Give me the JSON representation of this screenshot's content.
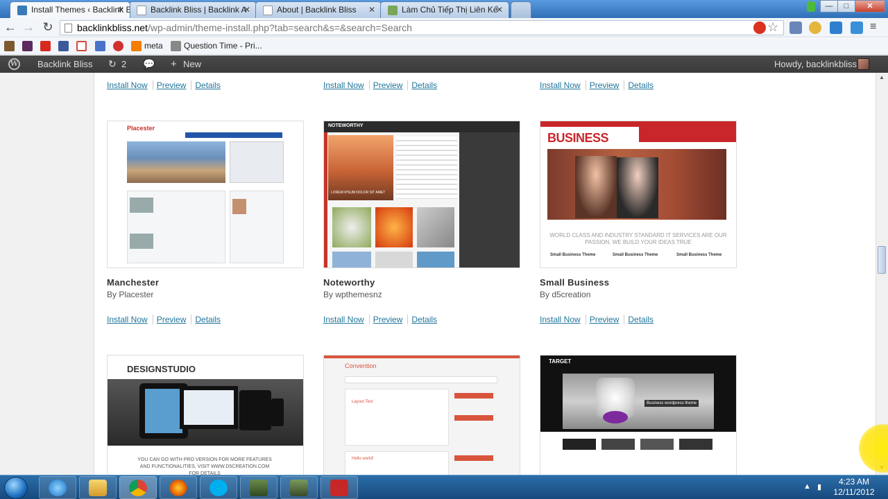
{
  "browser": {
    "tabs": [
      {
        "title": "Install Themes ‹ Backlink B",
        "active": true
      },
      {
        "title": "Backlink Bliss | Backlink A",
        "active": false
      },
      {
        "title": "About | Backlink Bliss",
        "active": false
      },
      {
        "title": "Làm Chủ Tiếp Thị Liên Kế",
        "active": false
      }
    ],
    "url_host": "backlinkbliss.net",
    "url_path": "/wp-admin/theme-install.php?tab=search&s=&search=Search",
    "bookmarks": [
      {
        "label": "",
        "icon": "chart-icon",
        "color": "#7a5a2e"
      },
      {
        "label": "",
        "icon": "imdb-icon",
        "color": "#5b2a5e"
      },
      {
        "label": "",
        "icon": "youtube-icon",
        "color": "#d62a1e"
      },
      {
        "label": "",
        "icon": "facebook-icon",
        "color": "#3b5998"
      },
      {
        "label": "",
        "icon": "gmail-icon",
        "color": "#d44a3a"
      },
      {
        "label": "",
        "icon": "heart-icon",
        "color": "#4a74c9"
      },
      {
        "label": "",
        "icon": "yelp-icon",
        "color": "#d2302e"
      },
      {
        "label": "meta",
        "icon": "blogger-icon",
        "color": "#f57d00"
      },
      {
        "label": "Question Time - Pri...",
        "icon": "car-icon",
        "color": "#777"
      }
    ]
  },
  "adminbar": {
    "site_name": "Backlink Bliss",
    "updates_count": "2",
    "new_label": "New",
    "howdy": "Howdy, backlinkbliss"
  },
  "actions": {
    "install": "Install Now",
    "preview": "Preview",
    "details": "Details"
  },
  "themes": [
    {
      "name": "Manchester",
      "author": "By Placester"
    },
    {
      "name": "Noteworthy",
      "author": "By wpthemesnz"
    },
    {
      "name": "Small Business",
      "author": "By d5creation"
    }
  ],
  "thumbnails": {
    "placester_logo": "Placester",
    "noteworthy_logo": "NOTEWORTHY",
    "noteworthy_caption": "LOREM IPSUM DOLOR SIT AMET",
    "business_logo": "BUSINESS",
    "business_slogan": "WORLD CLASS AND INDUSTRY STANDARD IT SERVICES ARE OUR PASSION. WE BUILD YOUR IDEAS TRUE",
    "business_cols": [
      "Small Business Theme",
      "Small Business Theme",
      "Small Business Theme"
    ],
    "design_logo": "DESIGNSTUDIO",
    "design_caption": "YOU CAN GO WITH PRO VERSION FOR MORE FEATURES AND FUNCTIONALITIES, VISIT WWW.D5CREATION.COM FOR DETAILS",
    "convention_logo": "Convention",
    "convention_post1": "Layout Test",
    "convention_post2": "Hello world!",
    "target_logo": "TARGET",
    "target_banner": "Business wordpress theme"
  },
  "taskbar": {
    "time": "4:23 AM",
    "date": "12/11/2012"
  }
}
